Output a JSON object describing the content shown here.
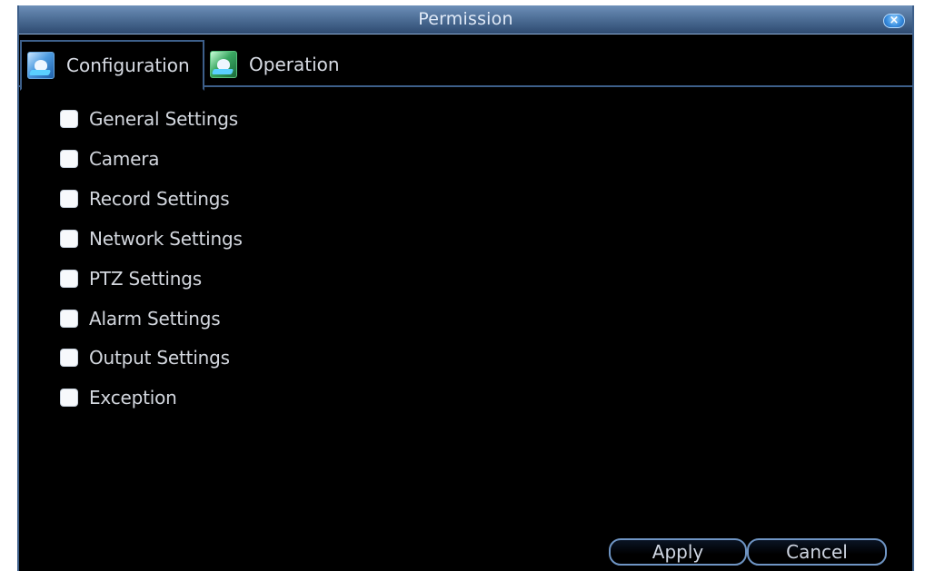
{
  "window": {
    "title": "Permission",
    "close_glyph": "×"
  },
  "tabs": [
    {
      "label": "Configuration",
      "icon": "configuration-icon",
      "active": true
    },
    {
      "label": "Operation",
      "icon": "operation-icon",
      "active": false
    }
  ],
  "permissions": [
    {
      "label": "General Settings",
      "checked": false
    },
    {
      "label": "Camera",
      "checked": false
    },
    {
      "label": "Record Settings",
      "checked": false
    },
    {
      "label": "Network Settings",
      "checked": false
    },
    {
      "label": "PTZ Settings",
      "checked": false
    },
    {
      "label": "Alarm Settings",
      "checked": false
    },
    {
      "label": "Output Settings",
      "checked": false
    },
    {
      "label": "Exception",
      "checked": false
    }
  ],
  "buttons": {
    "apply": "Apply",
    "cancel": "Cancel"
  },
  "colors": {
    "titlebar": "#4f7098",
    "border": "#3d5f8a",
    "background": "#000000"
  }
}
